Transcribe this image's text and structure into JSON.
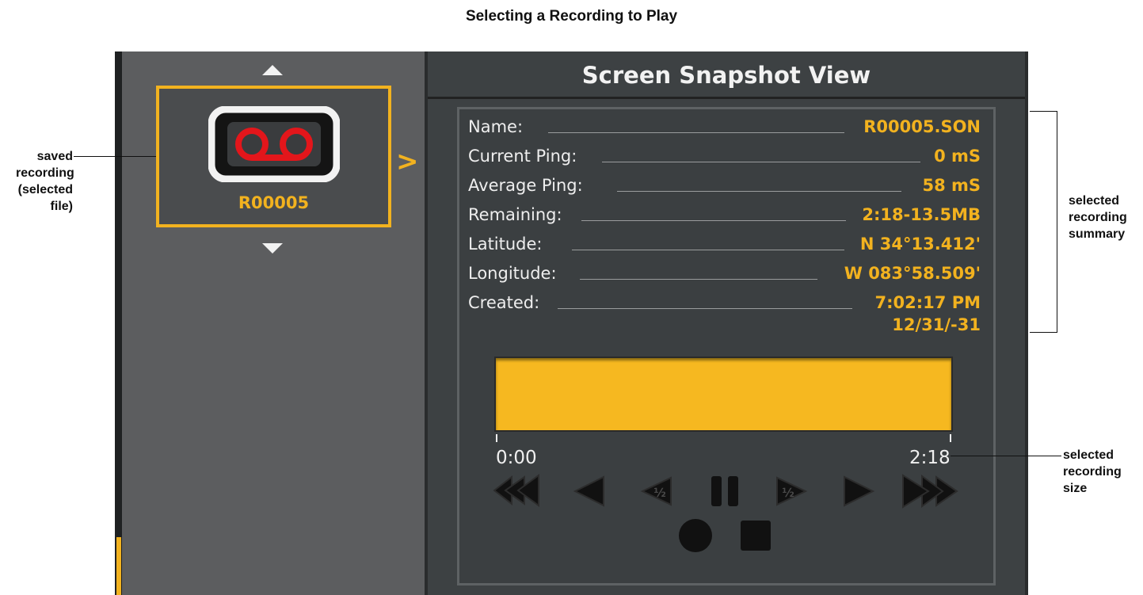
{
  "figure_title": "Selecting a Recording to Play",
  "header": {
    "title": "Screen Snapshot View"
  },
  "file_list": {
    "selected_file": "R00005"
  },
  "summary": {
    "rows": [
      {
        "label": "Name:",
        "value": "R00005.SON"
      },
      {
        "label": "Current Ping:",
        "value": "0 mS"
      },
      {
        "label": "Average Ping:",
        "value": "58 mS"
      },
      {
        "label": "Remaining:",
        "value": "2:18-13.5MB"
      },
      {
        "label": "Latitude:",
        "value": "N 34°13.412'"
      },
      {
        "label": "Longitude:",
        "value": "W 083°58.509'"
      },
      {
        "label": "Created:",
        "value": "7:02:17 PM"
      }
    ],
    "created_date": "12/31/-31"
  },
  "playback": {
    "start_time": "0:00",
    "end_time": "2:18",
    "progress_fraction": 1.0,
    "controls": [
      "fast-rewind",
      "rewind",
      "half-speed-rewind",
      "pause",
      "half-speed-forward",
      "play",
      "fast-forward",
      "record",
      "stop"
    ]
  },
  "annotations": {
    "left_lines": [
      "saved",
      "recording",
      "(selected",
      "file)"
    ],
    "summary_lines": [
      "selected",
      "recording",
      "summary"
    ],
    "size_lines": [
      "selected",
      "recording",
      "size"
    ]
  },
  "colors": {
    "accent": "#f2b21f",
    "panel": "#3d4143",
    "list_panel": "#5c5d5f",
    "record_red": "#e3161b"
  }
}
